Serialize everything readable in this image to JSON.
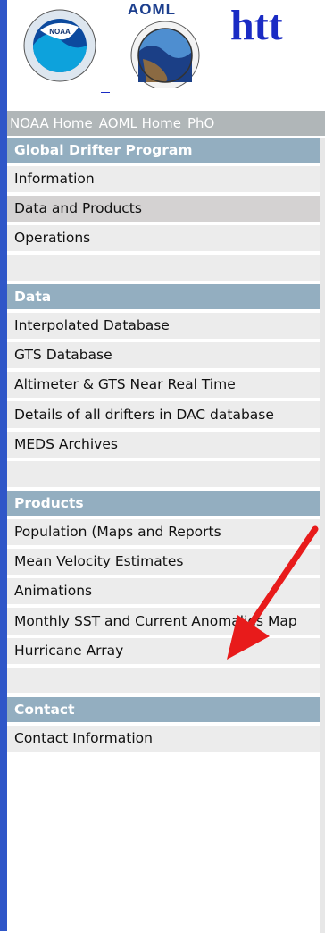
{
  "header": {
    "aoml_logo_text": "AOML",
    "site_url_fragment": "htt"
  },
  "topnav": {
    "links": [
      "NOAA Home",
      "AOML Home",
      "PhO"
    ]
  },
  "sections": [
    {
      "title": "Global Drifter Program",
      "items": [
        "Information",
        "Data and Products",
        "Operations"
      ],
      "active_index": 1
    },
    {
      "title": "Data",
      "items": [
        "Interpolated Database",
        "GTS Database",
        "Altimeter & GTS Near Real Time",
        "Details of all drifters in DAC database",
        "MEDS Archives"
      ]
    },
    {
      "title": "Products",
      "items": [
        "Population (Maps and Reports",
        "Mean Velocity Estimates",
        "Animations",
        "Monthly SST and Current Anomalies Map",
        "Hurricane Array"
      ]
    },
    {
      "title": "Contact",
      "items": [
        "Contact Information"
      ]
    }
  ],
  "colors": {
    "left_border": "#2f56c8",
    "section_header": "#93aec0",
    "menu_item": "#ececec",
    "active_item": "#d4d2d2",
    "topnav": "#b0b6b8",
    "annotation_arrow": "#e81b1b",
    "url_text": "#1a2bc4"
  }
}
